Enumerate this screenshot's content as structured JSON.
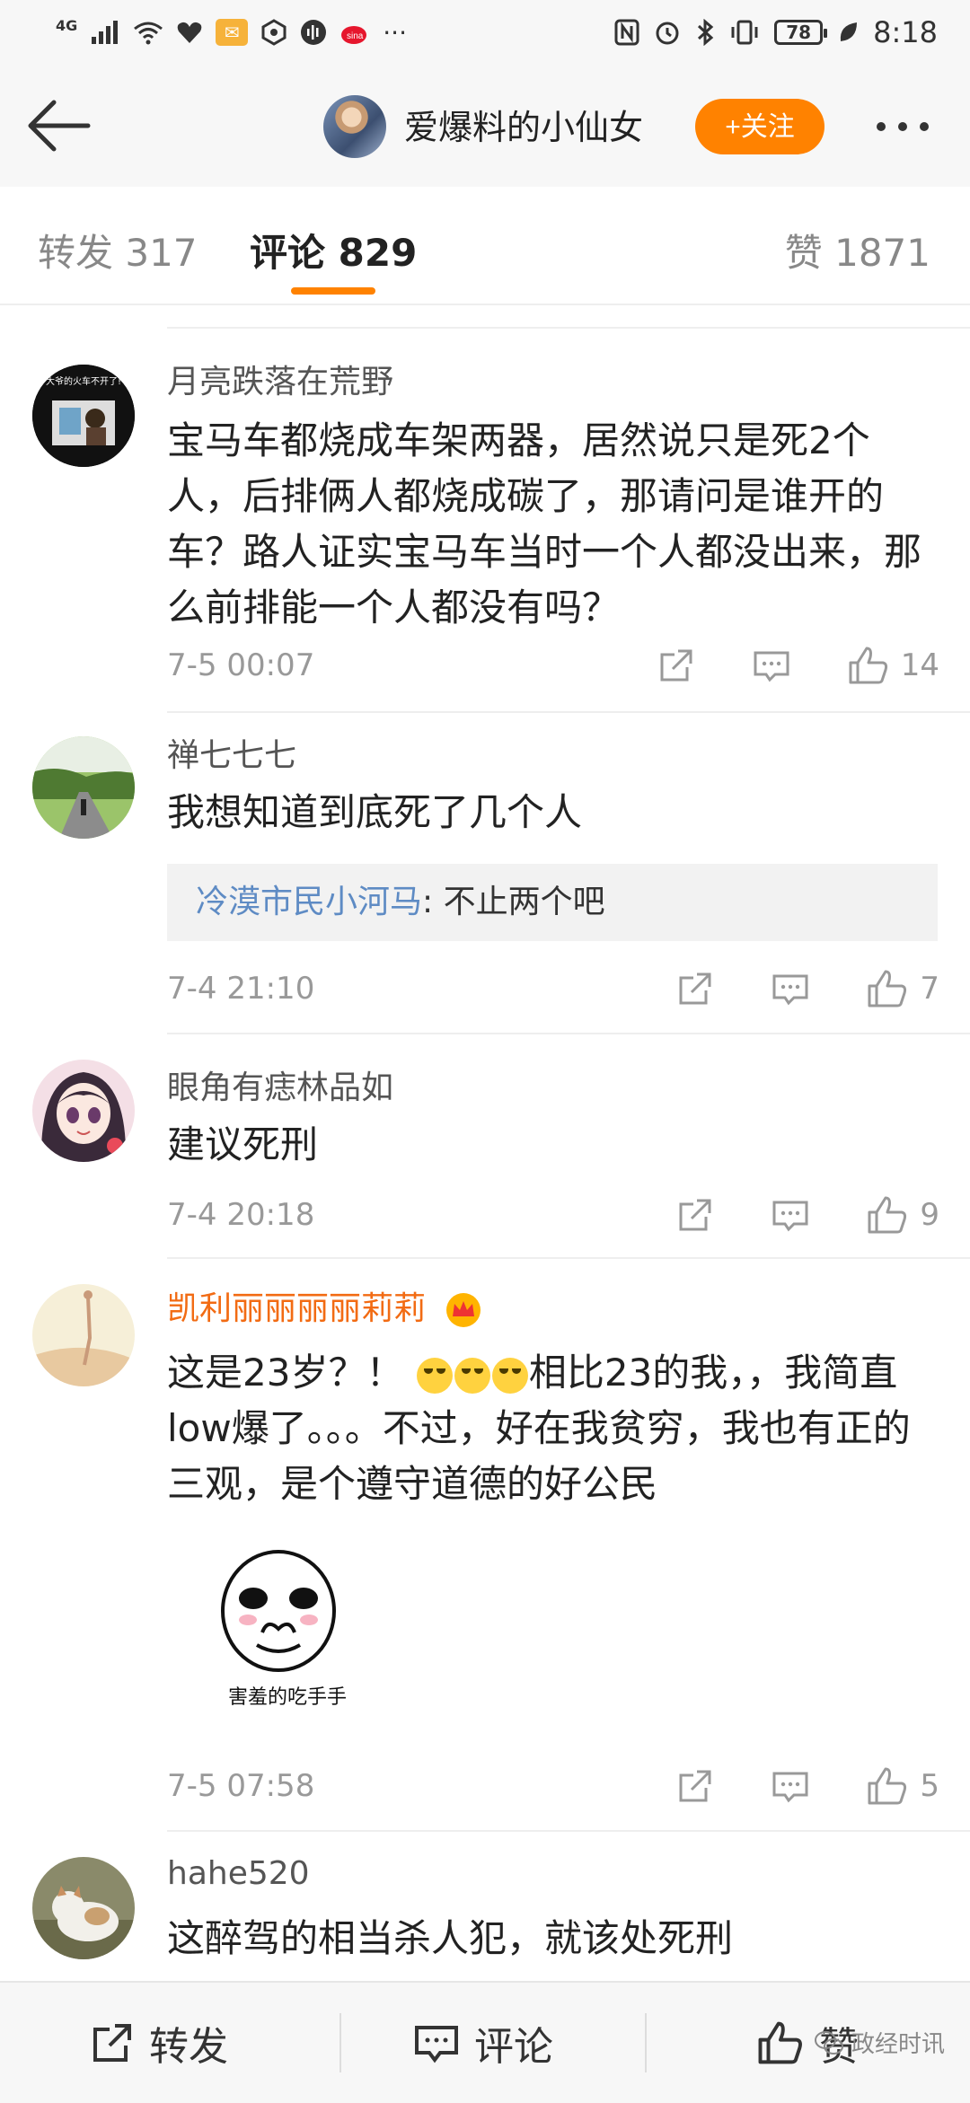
{
  "status_bar": {
    "network": "4G",
    "battery": "78",
    "time": "8:18"
  },
  "header": {
    "title": "爱爆料的小仙女",
    "follow_label": "+关注"
  },
  "tabs": {
    "repost": "转发 317",
    "comment": "评论 829",
    "likes": "赞 1871"
  },
  "comments": [
    {
      "name": "月亮跌落在荒野",
      "avatar_caption": "大爷的火车不开了!",
      "text": "宝马车都烧成车架两器，居然说只是死2个人，后排俩人都烧成碳了，那请问是谁开的车？路人证实宝马车当时一个人都没出来，那么前排能一个人都没有吗？",
      "time": "7-5 00:07",
      "likes": "14"
    },
    {
      "name": "禅七七七",
      "text": "我想知道到底死了几个人",
      "reply_name": "冷漠市民小河马",
      "reply_text": ": 不止两个吧",
      "time": "7-4 21:10",
      "likes": "7"
    },
    {
      "name": "眼角有痣林品如",
      "text": "建议死刑",
      "time": "7-4 20:18",
      "likes": "9"
    },
    {
      "name": "凯利丽丽丽丽莉莉",
      "text_a": "这是23岁？！",
      "text_b": "相比23的我，，我简直low爆了。。。不过，好在我贫穷，我也有正的三观，是个遵守道德的好公民",
      "sticker_caption": "害羞的吃手手",
      "time": "7-5 07:58",
      "likes": "5"
    },
    {
      "name": "hahe520",
      "text": "这醉驾的相当杀人犯，就该处死刑"
    }
  ],
  "bottom_bar": {
    "repost": "转发",
    "comment": "评论",
    "like": "赞",
    "watermark": "政经时讯"
  },
  "colors": {
    "accent": "#ff8200",
    "reply_name": "#5e8bc4",
    "vip_name": "#f26b13"
  }
}
